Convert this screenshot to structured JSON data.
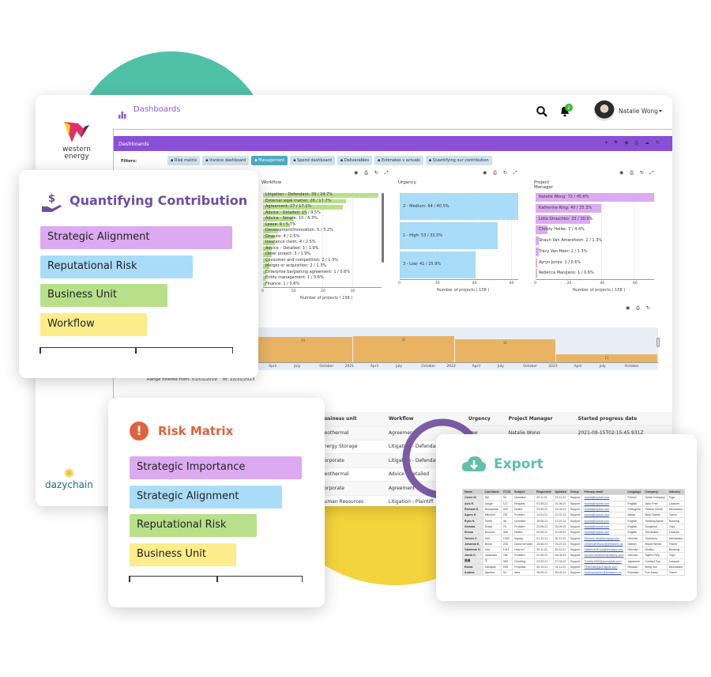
{
  "header": {
    "title": "Dashboards",
    "notifications": "2",
    "user_name": "Natalie Wong"
  },
  "brand": {
    "client_logo": "western energy",
    "product_logo": "dazychain"
  },
  "dashboard": {
    "bar_title": "Dashboards",
    "filters_label": "Filters:",
    "filters": [
      {
        "label": "Risk matrix",
        "active": false
      },
      {
        "label": "Invoice dashboard",
        "active": false
      },
      {
        "label": "Management",
        "active": true
      },
      {
        "label": "Spend dashboard",
        "active": false
      },
      {
        "label": "Deliverables",
        "active": false
      },
      {
        "label": "Estimates v actuals",
        "active": false
      },
      {
        "label": "Quantifying our contribution",
        "active": false
      }
    ],
    "range_label": "Range filtered from:",
    "range_from": "01/01/2019",
    "range_to_label": "to:",
    "range_to": "12/31/2023"
  },
  "chart_data": [
    {
      "type": "bar",
      "orientation": "horizontal",
      "title": "Workflow",
      "xlabel": "Number of projects ( 158 )",
      "xlim": [
        0,
        40
      ],
      "xticks": [
        0,
        10,
        20,
        30
      ],
      "color": "#b8e08a",
      "categories": [
        "Litigation - Defendant: 39 / 24.7%",
        "External legal matter: 28 / 17.7%",
        "Agreement: 27 / 17.1%",
        "Advice - Detailed: 15 / 9.5%",
        "Advice - Simple: 10 / 6.3%",
        "Lease: 9 / 5.7%",
        "Development/innovation: 5 / 3.2%",
        "Dispute: 4 / 2.5%",
        "Insurance claim: 4 / 2.5%",
        "Advice – Detailed: 3 / 1.9%",
        "Other project: 3 / 1.9%",
        "Consumer and competition: 2 / 1.3%",
        "Merger or acquisition: 2 / 1.3%",
        "Enterprise bargaining agreement: 1 / 0.6%",
        "Entity management: 1 / 0.6%",
        "Finance: 1 / 0.6%"
      ],
      "values": [
        39,
        28,
        27,
        15,
        10,
        9,
        5,
        4,
        4,
        3,
        3,
        2,
        2,
        1,
        1,
        1
      ]
    },
    {
      "type": "bar",
      "orientation": "horizontal",
      "title": "Urgency",
      "xlabel": "Number of projects ( 158 )",
      "xlim": [
        0,
        64
      ],
      "xticks": [
        0,
        20,
        40,
        60
      ],
      "color": "#a8dcf8",
      "categories": [
        "2 - Medium: 64 / 40.5%",
        "1 - High: 53 / 33.5%",
        "3 - Low: 41 / 25.9%"
      ],
      "values": [
        64,
        53,
        41
      ]
    },
    {
      "type": "bar",
      "orientation": "horizontal",
      "title": "Project Manager",
      "xlabel": "Number of projects ( 158 )",
      "xlim": [
        0,
        72
      ],
      "xticks": [
        0,
        20,
        40,
        60
      ],
      "color": "#dcaaf0",
      "categories": [
        "Natalie Wong: 72 / 45.6%",
        "Katherine King: 40 / 25.3%",
        "Lidia Straschko: 33 / 20.9%",
        "Christy Heller: 7 / 4.4%",
        "Shaun Van Amersfoort: 2 / 1.3%",
        "Tracy Van Heer: 2 / 1.3%",
        "Ayryn Jones: 1 / 0.6%",
        "Rebecca Mangano: 1 / 0.6%"
      ],
      "values": [
        72,
        40,
        33,
        7,
        2,
        2,
        1,
        1
      ]
    },
    {
      "type": "bar",
      "title": "",
      "color": "#e8b464",
      "categories": [
        "2020",
        "2021",
        "2022",
        "2023"
      ],
      "values": [
        34,
        35,
        31,
        11
      ],
      "xticks": [
        "April",
        "July",
        "October",
        "2021",
        "April",
        "July",
        "October",
        "2022",
        "April",
        "July",
        "October",
        "2023",
        "April",
        "July",
        "October"
      ]
    }
  ],
  "table": {
    "columns": [
      "Business unit",
      "Workflow",
      "Urgency",
      "Project Manager",
      "Started progress date"
    ],
    "rows": [
      [
        "Geothermal",
        "Agreement",
        "Low",
        "Natalie Wong",
        "2021-09-15T02:15:45.931Z"
      ],
      [
        "Energy Storage",
        "Litigation - Defendant",
        "",
        "",
        ""
      ],
      [
        "Corporate",
        "Litigation - Defendant",
        "",
        "",
        ""
      ],
      [
        "Geothermal",
        "Advice - Detailed",
        "",
        "",
        ""
      ],
      [
        "Corporate",
        "Agreement",
        "",
        "",
        ""
      ],
      [
        "Human Resources",
        "Litigation - Plaintiff",
        "",
        "",
        ""
      ]
    ]
  },
  "quantifying": {
    "title": "Quantifying Contribution",
    "icon": "hand-dollar-icon",
    "color": "#6b4fa0",
    "items": [
      {
        "label": "Strategic Alignment",
        "color": "#dcaaf0"
      },
      {
        "label": "Reputational Risk",
        "color": "#a8dcf8"
      },
      {
        "label": "Business Unit",
        "color": "#b8e08a"
      },
      {
        "label": "Workflow",
        "color": "#fcec8a"
      }
    ]
  },
  "risk": {
    "title": "Risk Matrix",
    "icon": "exclamation-circle-icon",
    "color": "#e0623a",
    "items": [
      {
        "label": "Strategic Importance",
        "color": "#dcaaf0"
      },
      {
        "label": "Strategic Alignment",
        "color": "#a8dcf8"
      },
      {
        "label": "Reputational Risk",
        "color": "#b8e08a"
      },
      {
        "label": "Business Unit",
        "color": "#fcec8a"
      }
    ]
  },
  "export": {
    "title": "Export",
    "icon": "cloud-download-icon",
    "color": "#5fbfa8",
    "columns": [
      "Name",
      "Last Name",
      "CT-ID",
      "Subject",
      "Requested",
      "Updated",
      "Group",
      "Primary email",
      "Language",
      "Company",
      "Industry"
    ],
    "rows": [
      [
        "Carrie M.",
        "Hill",
        "32",
        "Question",
        "20.11.21",
        "22.11.21",
        "Support",
        "repeat@repeat.com",
        "French",
        "Great Company",
        "Toys"
      ],
      [
        "Avis R.",
        "Daigle",
        "112",
        "Request",
        "01.05.21",
        "01.06.21",
        "Support",
        "repeat@repeat.com",
        "English",
        "John Free",
        "Leasure"
      ],
      [
        "Richard D.",
        "Humphries",
        "543",
        "Notice",
        "23.03.21",
        "01.04.21",
        "Support",
        "repeat@repeat.com",
        "Portugese",
        "Partner World",
        "Mechanics"
      ],
      [
        "Agnes E.",
        "Mitchem",
        "231",
        "Problem",
        "14.01.21",
        "01.02.21",
        "Support",
        "repeat@repeat.com",
        "Italian",
        "Best Tickets",
        "Travel"
      ],
      [
        "Ryan N.",
        "Smith",
        "46",
        "Question",
        "15.06.21",
        "17.07.21",
        "Support",
        "repeat@repeat.com",
        "English",
        "Seeking Alpha",
        "Booking"
      ],
      [
        "Gemma",
        "Grace",
        "75",
        "Problem",
        "23.08.21",
        "01.09.21",
        "Support",
        "repeat@repeat.com",
        "English",
        "Doughnut",
        "Toys"
      ],
      [
        "Emma",
        "Brunker",
        "456",
        "Notice",
        "04.09.21",
        "10.09.21",
        "Support",
        "repeat@repeat.com",
        "English",
        "Terminator",
        "Leasure"
      ],
      [
        "Torben C.",
        "Juhl",
        "1000",
        "Inquiry",
        "01.10.21",
        "30.10.21",
        "Support",
        "TorbenCJuhl@armyspy.com",
        "German",
        "Checkers",
        "Mechanics"
      ],
      [
        "Johanna K.",
        "Bruun",
        "236",
        "Does not work",
        "15.06.21",
        "01.07.21",
        "Support",
        "JohannaKBruun@teleworm.us",
        "Danish",
        "Brand Works",
        "Travel"
      ],
      [
        "Valdemar N.",
        "Lind",
        "1011",
        "How to?",
        "20.11.21",
        "25.11.21",
        "Support",
        "ValdemarNLind@armyspy.com",
        "German",
        "Wolfes",
        "Booking"
      ],
      [
        "Jacob K.",
        "Johansen",
        "780",
        "Problem",
        "01.05.21",
        "04.05.21",
        "Support",
        "JacobKJohansen@dayrep.com",
        "German",
        "Tigers Prep",
        "Toys"
      ],
      [
        "葉珊",
        "王",
        "453",
        "Greeting",
        "23.03.21",
        "27.03.21",
        "Support",
        "Tunelty1990@jourrapide.com",
        "Japanese",
        "Contact Eye",
        "Leasure"
      ],
      [
        "Biswa",
        "Saxapoe",
        "239",
        "Proposal",
        "30.10.21",
        "04.11.21",
        "Support",
        "Peter548@jourrapide.com",
        "Russian",
        "Bring Jou",
        "Mechanics"
      ],
      [
        "Andrea",
        "Aachen",
        "34",
        "Idea",
        "15.09.21",
        "30.09.21",
        "Support",
        "AndreaAachen@teleworm.us",
        "Estonian",
        "Fun Down",
        "Travel"
      ]
    ]
  }
}
